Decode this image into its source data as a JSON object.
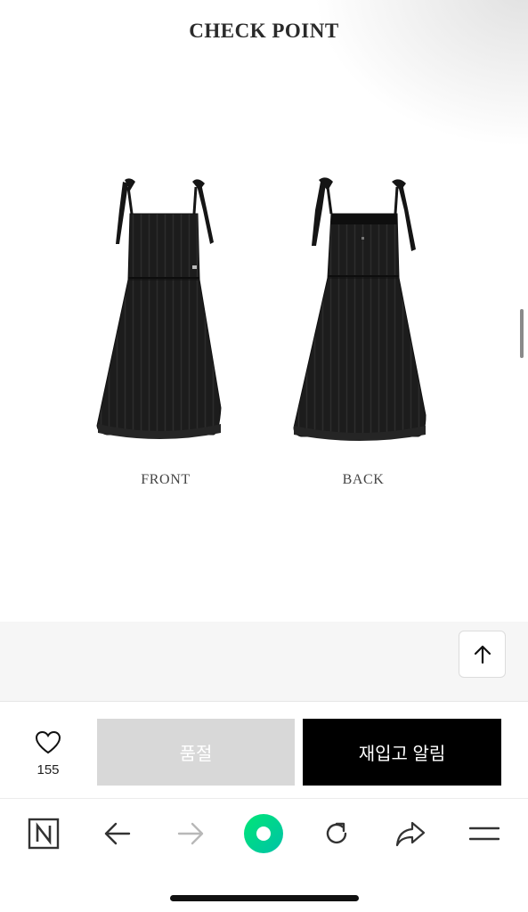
{
  "section": {
    "title": "CHECK POINT"
  },
  "views": [
    {
      "caption": "FRONT"
    },
    {
      "caption": "BACK"
    }
  ],
  "like": {
    "count": "155",
    "icon": "heart-outline-icon"
  },
  "buttons": {
    "soldout_label": "품절",
    "restock_label": "재입고 알림",
    "top_icon": "arrow-up-icon"
  },
  "browser_nav": {
    "icons": [
      "naver-n-icon",
      "back-arrow-icon",
      "forward-arrow-icon",
      "green-circle-icon",
      "refresh-icon",
      "share-icon",
      "menu-icon"
    ]
  },
  "colors": {
    "accent_green": "#00d564",
    "restock_bg": "#000000",
    "soldout_bg": "#d8d8d8"
  }
}
